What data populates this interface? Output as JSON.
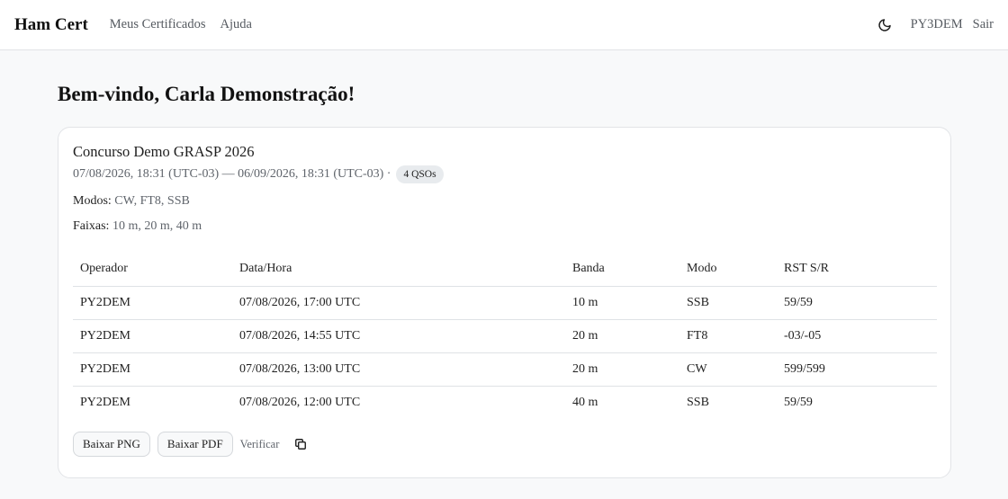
{
  "navbar": {
    "brand": "Ham Cert",
    "links": [
      "Meus Certificados",
      "Ajuda"
    ],
    "user": "PY3DEM",
    "logout": "Sair",
    "theme_icon": "moon-icon"
  },
  "main": {
    "welcome": "Bem-vindo, Carla Demonstração!"
  },
  "card": {
    "title": "Concurso Demo GRASP 2026",
    "dates": "07/08/2026, 18:31 (UTC-03) — 06/09/2026, 18:31 (UTC-03) ·",
    "qso_badge": "4 QSOs",
    "modes_label": "Modos:",
    "modes_value": "CW, FT8, SSB",
    "bands_label": "Faixas:",
    "bands_value": "10 m, 20 m, 40 m",
    "table": {
      "headers": [
        "Operador",
        "Data/Hora",
        "Banda",
        "Modo",
        "RST S/R"
      ],
      "rows": [
        [
          "PY2DEM",
          "07/08/2026, 17:00 UTC",
          "10 m",
          "SSB",
          "59/59"
        ],
        [
          "PY2DEM",
          "07/08/2026, 14:55 UTC",
          "20 m",
          "FT8",
          "-03/-05"
        ],
        [
          "PY2DEM",
          "07/08/2026, 13:00 UTC",
          "20 m",
          "CW",
          "599/599"
        ],
        [
          "PY2DEM",
          "07/08/2026, 12:00 UTC",
          "40 m",
          "SSB",
          "59/59"
        ]
      ]
    },
    "actions": {
      "png": "Baixar PNG",
      "pdf": "Baixar PDF",
      "verify": "Verificar",
      "copy_icon": "copy-icon"
    }
  }
}
